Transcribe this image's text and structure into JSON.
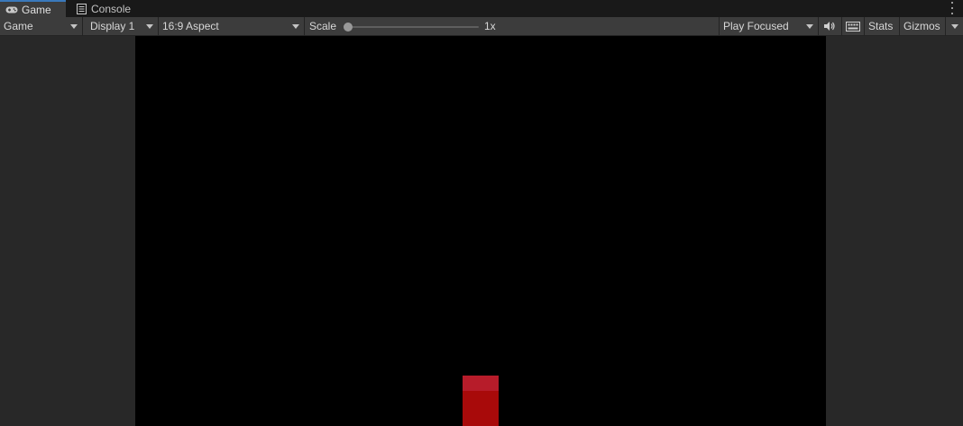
{
  "tabs": [
    {
      "label": "Game",
      "icon": "gamepad-icon",
      "active": true
    },
    {
      "label": "Console",
      "icon": "console-icon",
      "active": false
    }
  ],
  "toolbar": {
    "view_mode": "Game",
    "display": "Display 1",
    "aspect": "16:9 Aspect",
    "scale_label": "Scale",
    "scale_value": "1x",
    "play_mode": "Play Focused",
    "stats_label": "Stats",
    "gizmos_label": "Gizmos"
  },
  "colors": {
    "active_tab_accent": "#3a79bb",
    "toolbar_bg": "#3c3c3c",
    "game_bg": "#000000",
    "cube_front": "#a80a0a",
    "cube_top": "#b71c2a"
  }
}
